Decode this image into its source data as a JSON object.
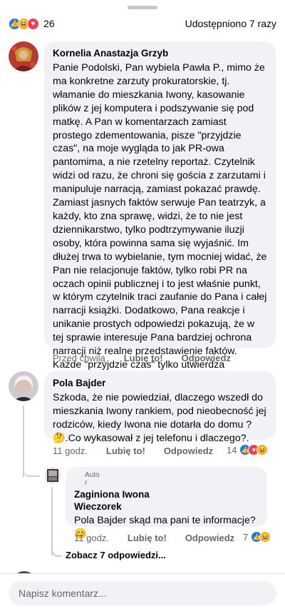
{
  "reactions": {
    "count": "26",
    "shares": "Udostępniono 7 razy",
    "colors": {
      "like": "#1877f2",
      "haha": "#f7b125",
      "love": "#f33e58"
    }
  },
  "comments": [
    {
      "author": "Kornelia Anastazja Grzyb",
      "text": "Panie Podolski, Pan wybiela Pawła P., mimo że ma konkretne zarzuty prokuratorskie, tj. włamanie do mieszkania Iwony, kasowanie plików z jej komputera i podszywanie się pod matkę. A Pan w komentarzach zamiast prostego zdementowania, pisze \"przyjdzie czas\", na moje wygląda to jak PR-owa pantomima, a nie rzetelny reportaż. Czytelnik widzi od razu, że chroni się gościa z zarzutami i manipuluje narracją, zamiast pokazać prawdę. Zamiast jasnych faktów serwuje Pan teatrzyk, a każdy, kto zna sprawę, widzi, że to nie jest dziennikarstwo, tylko podtrzymywanie iluzji osoby, która powinna sama się wyjaśnić. Im dłużej trwa to wybielanie, tym mocniej widać, że Pan nie relacjonuje faktów, tylko robi PR na oczach opinii publicznej i to jest właśnie punkt, w którym czytelnik traci zaufanie do Pana i całej narracji książki. Dodatkowo, Pana reakcje i unikanie prostych odpowiedzi pokazują, że w tej sprawie interesuje Pana bardziej ochrona narracji niż realne przedstawienie faktów. Każde \"przyjdzie czas\" tylko utwierdza wrażenie, że Pan próbuje manipulować emocjami odbiorców, zamiast uczciwie im relacjonować zdarzenia. Pozdrawiam.",
      "time": "Przed chwilą",
      "like": "Lubię to!",
      "reply": "Odpowiedz"
    },
    {
      "author": "Pola Bajder",
      "text": "Szkoda, że nie powiedział, dlaczego wszedł do mieszkania Iwony rankiem, pod nieobecność jej rodziców, kiedy Iwona nie dotarła do domu ? 🤔.Co wykasował z jej telefonu i dlaczego?.",
      "time": "11 godz.",
      "like": "Lubię to!",
      "reply": "Odpowiedz",
      "reaction_count": "14"
    }
  ],
  "reply": {
    "badge": "Auto\nr",
    "author_line1": "Zaginiona Iwona",
    "author_line2": "Wieczorek",
    "text": "Pola Bajder skąd ma pani te informacje? 😊",
    "time": "11 godz.",
    "like": "Lubię to!",
    "reply": "Odpowiedz",
    "reaction_count": "7"
  },
  "see_more": "Zobacz 7 odpowiedzi...",
  "input": {
    "placeholder": "Napisz komentarz..."
  }
}
